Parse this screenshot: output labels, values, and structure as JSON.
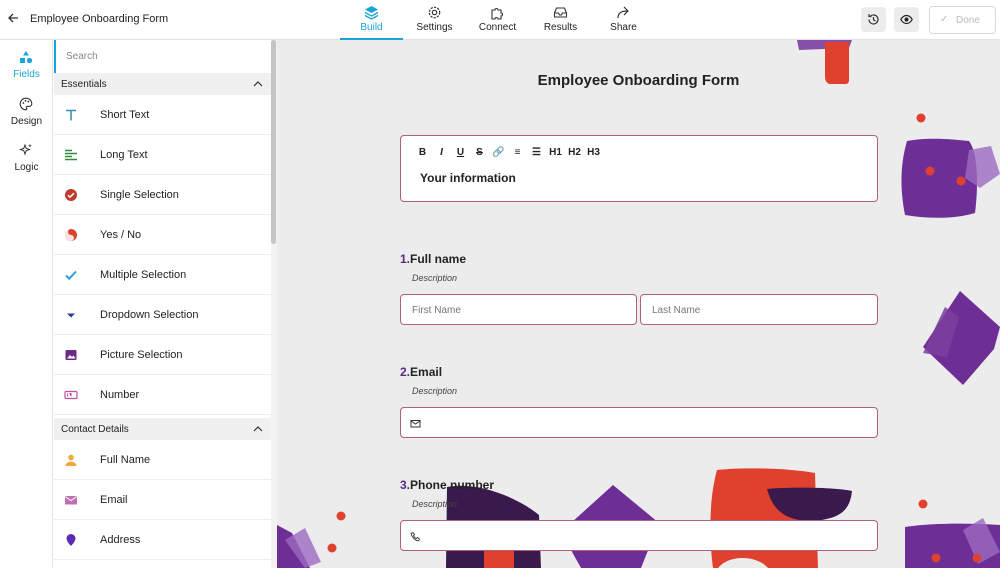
{
  "app": {
    "title": "Employee Onboarding Form",
    "back_icon": "arrow-left-icon"
  },
  "nav": [
    {
      "label": "Build",
      "icon": "layers-icon",
      "active": true
    },
    {
      "label": "Settings",
      "icon": "gear-icon",
      "active": false
    },
    {
      "label": "Connect",
      "icon": "puzzle-icon",
      "active": false
    },
    {
      "label": "Results",
      "icon": "inbox-icon",
      "active": false
    },
    {
      "label": "Share",
      "icon": "share-arrow-icon",
      "active": false
    }
  ],
  "toolbar": {
    "history_icon": "history-icon",
    "preview_icon": "eye-icon",
    "done_label": "Done"
  },
  "rail": [
    {
      "label": "Fields",
      "icon": "shapes-icon",
      "active": true
    },
    {
      "label": "Design",
      "icon": "palette-icon",
      "active": false
    },
    {
      "label": "Logic",
      "icon": "sparkles-icon",
      "active": false
    }
  ],
  "panel": {
    "search_placeholder": "Search",
    "sections": [
      {
        "title": "Essentials",
        "items": [
          {
            "label": "Short Text",
            "icon": "text-t-icon",
            "color": "#3b8fb6"
          },
          {
            "label": "Long Text",
            "icon": "paragraph-lines-icon",
            "color": "#2e8b3e"
          },
          {
            "label": "Single Selection",
            "icon": "check-circle-icon",
            "color": "#c0392b"
          },
          {
            "label": "Yes / No",
            "icon": "yin-yang-icon",
            "color": "#d9442b"
          },
          {
            "label": "Multiple Selection",
            "icon": "checkmark-icon",
            "color": "#2a9fd6"
          },
          {
            "label": "Dropdown Selection",
            "icon": "caret-down-icon",
            "color": "#2b3a8c"
          },
          {
            "label": "Picture Selection",
            "icon": "picture-icon",
            "color": "#6a2a86"
          },
          {
            "label": "Number",
            "icon": "number-box-icon",
            "color": "#c04d9e"
          }
        ]
      },
      {
        "title": "Contact Details",
        "items": [
          {
            "label": "Full Name",
            "icon": "person-icon",
            "color": "#f0a93a"
          },
          {
            "label": "Email",
            "icon": "envelope-icon",
            "color": "#c070b0"
          },
          {
            "label": "Address",
            "icon": "map-pin-icon",
            "color": "#5a2bb5"
          }
        ]
      }
    ]
  },
  "form": {
    "title": "Employee Onboarding Form",
    "statement": {
      "format_buttons": [
        "B",
        "I",
        "U",
        "S",
        "🔗",
        "≡",
        "☰",
        "H1",
        "H2",
        "H3"
      ],
      "text": "Your information"
    },
    "questions": [
      {
        "number": "1.",
        "title": "Full name",
        "description": "Description",
        "fields": [
          "First Name",
          "Last Name"
        ]
      },
      {
        "number": "2.",
        "title": "Email",
        "description": "Description",
        "icon": "envelope-icon"
      },
      {
        "number": "3.",
        "title": "Phone number",
        "description": "Description",
        "icon": "phone-icon"
      }
    ]
  }
}
